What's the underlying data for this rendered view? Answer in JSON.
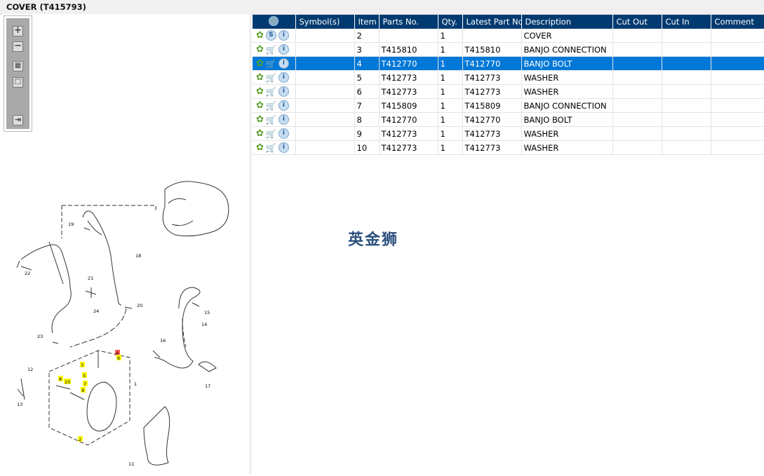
{
  "window_title": "COVER (T415793)",
  "toolbar": {
    "zoom_in": "+",
    "zoom_out": "−",
    "fit_all": "▦",
    "actual": "□",
    "export": "⇥"
  },
  "table": {
    "columns": [
      "",
      "Symbol(s)",
      "Item",
      "Parts No.",
      "Qty.",
      "Latest Part No.",
      "Description",
      "Cut Out",
      "Cut In",
      "Comment"
    ],
    "rows": [
      {
        "icon": "S",
        "symbols": "",
        "item": "2",
        "part": "",
        "qty": "1",
        "latest": "",
        "desc": "COVER",
        "cut_out": "",
        "cut_in": "",
        "comment": ""
      },
      {
        "icon": "cart",
        "symbols": "",
        "item": "3",
        "part": "T415810",
        "qty": "1",
        "latest": "T415810",
        "desc": "BANJO CONNECTION",
        "cut_out": "",
        "cut_in": "",
        "comment": ""
      },
      {
        "icon": "cart",
        "symbols": "",
        "item": "4",
        "part": "T412770",
        "qty": "1",
        "latest": "T412770",
        "desc": "BANJO BOLT",
        "cut_out": "",
        "cut_in": "",
        "comment": "",
        "selected": true
      },
      {
        "icon": "cart",
        "symbols": "",
        "item": "5",
        "part": "T412773",
        "qty": "1",
        "latest": "T412773",
        "desc": "WASHER",
        "cut_out": "",
        "cut_in": "",
        "comment": ""
      },
      {
        "icon": "cart",
        "symbols": "",
        "item": "6",
        "part": "T412773",
        "qty": "1",
        "latest": "T412773",
        "desc": "WASHER",
        "cut_out": "",
        "cut_in": "",
        "comment": ""
      },
      {
        "icon": "cart",
        "symbols": "",
        "item": "7",
        "part": "T415809",
        "qty": "1",
        "latest": "T415809",
        "desc": "BANJO CONNECTION",
        "cut_out": "",
        "cut_in": "",
        "comment": ""
      },
      {
        "icon": "cart",
        "symbols": "",
        "item": "8",
        "part": "T412770",
        "qty": "1",
        "latest": "T412770",
        "desc": "BANJO BOLT",
        "cut_out": "",
        "cut_in": "",
        "comment": ""
      },
      {
        "icon": "cart",
        "symbols": "",
        "item": "9",
        "part": "T412773",
        "qty": "1",
        "latest": "T412773",
        "desc": "WASHER",
        "cut_out": "",
        "cut_in": "",
        "comment": ""
      },
      {
        "icon": "cart",
        "symbols": "",
        "item": "10",
        "part": "T412773",
        "qty": "1",
        "latest": "T412773",
        "desc": "WASHER",
        "cut_out": "",
        "cut_in": "",
        "comment": ""
      }
    ]
  },
  "watermark": "英金狮",
  "diagram": {
    "callouts": [
      "19",
      "22",
      "21",
      "18",
      "24",
      "20",
      "15",
      "14",
      "23",
      "16",
      "12",
      "1",
      "13",
      "17",
      "11",
      "2",
      "3",
      "4",
      "6",
      "5",
      "7",
      "8",
      "10",
      "9"
    ]
  },
  "colors": {
    "header": "#003a70",
    "selected": "#0078d7",
    "highlight": "#ffff00"
  }
}
